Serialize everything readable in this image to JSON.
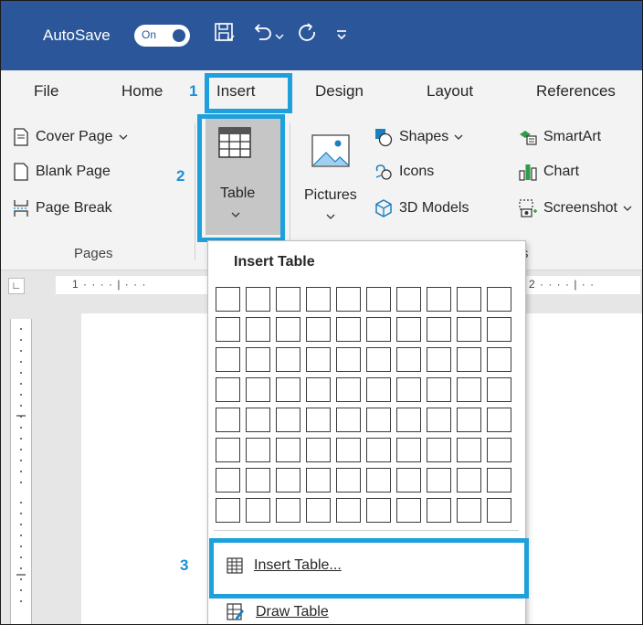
{
  "titlebar": {
    "autosave_label": "AutoSave",
    "toggle_state": "On",
    "icons": [
      "save-icon",
      "undo-icon",
      "undo-dropdown-icon",
      "redo-icon",
      "customize-qat-icon"
    ]
  },
  "tabs": {
    "file": "File",
    "home": "Home",
    "insert": "Insert",
    "design": "Design",
    "layout": "Layout",
    "references": "References"
  },
  "steps": {
    "one": "1",
    "two": "2",
    "three": "3"
  },
  "ribbon": {
    "pages_group": {
      "cover_page": "Cover Page",
      "blank_page": "Blank Page",
      "page_break": "Page Break",
      "label": "Pages"
    },
    "table_button": "Table",
    "pictures_button": "Pictures",
    "illustrations": {
      "shapes": "Shapes",
      "icons": "Icons",
      "models": "3D Models",
      "smartart": "SmartArt",
      "chart": "Chart",
      "screenshot": "Screenshot"
    },
    "group_label_partial": "s"
  },
  "ruler": {
    "left_text": "1 · · · · | · · ·",
    "right_text": "2 · · · · | · ·"
  },
  "dropdown": {
    "title": "Insert Table",
    "grid": {
      "columns": 10,
      "rows": 8
    },
    "insert_table": "Insert Table...",
    "draw_table": "Draw Table"
  },
  "colors": {
    "titlebar": "#2b579a",
    "ribbon": "#f3f3f3",
    "callout": "#1ea0dc",
    "step_number": "#1a90d9"
  }
}
